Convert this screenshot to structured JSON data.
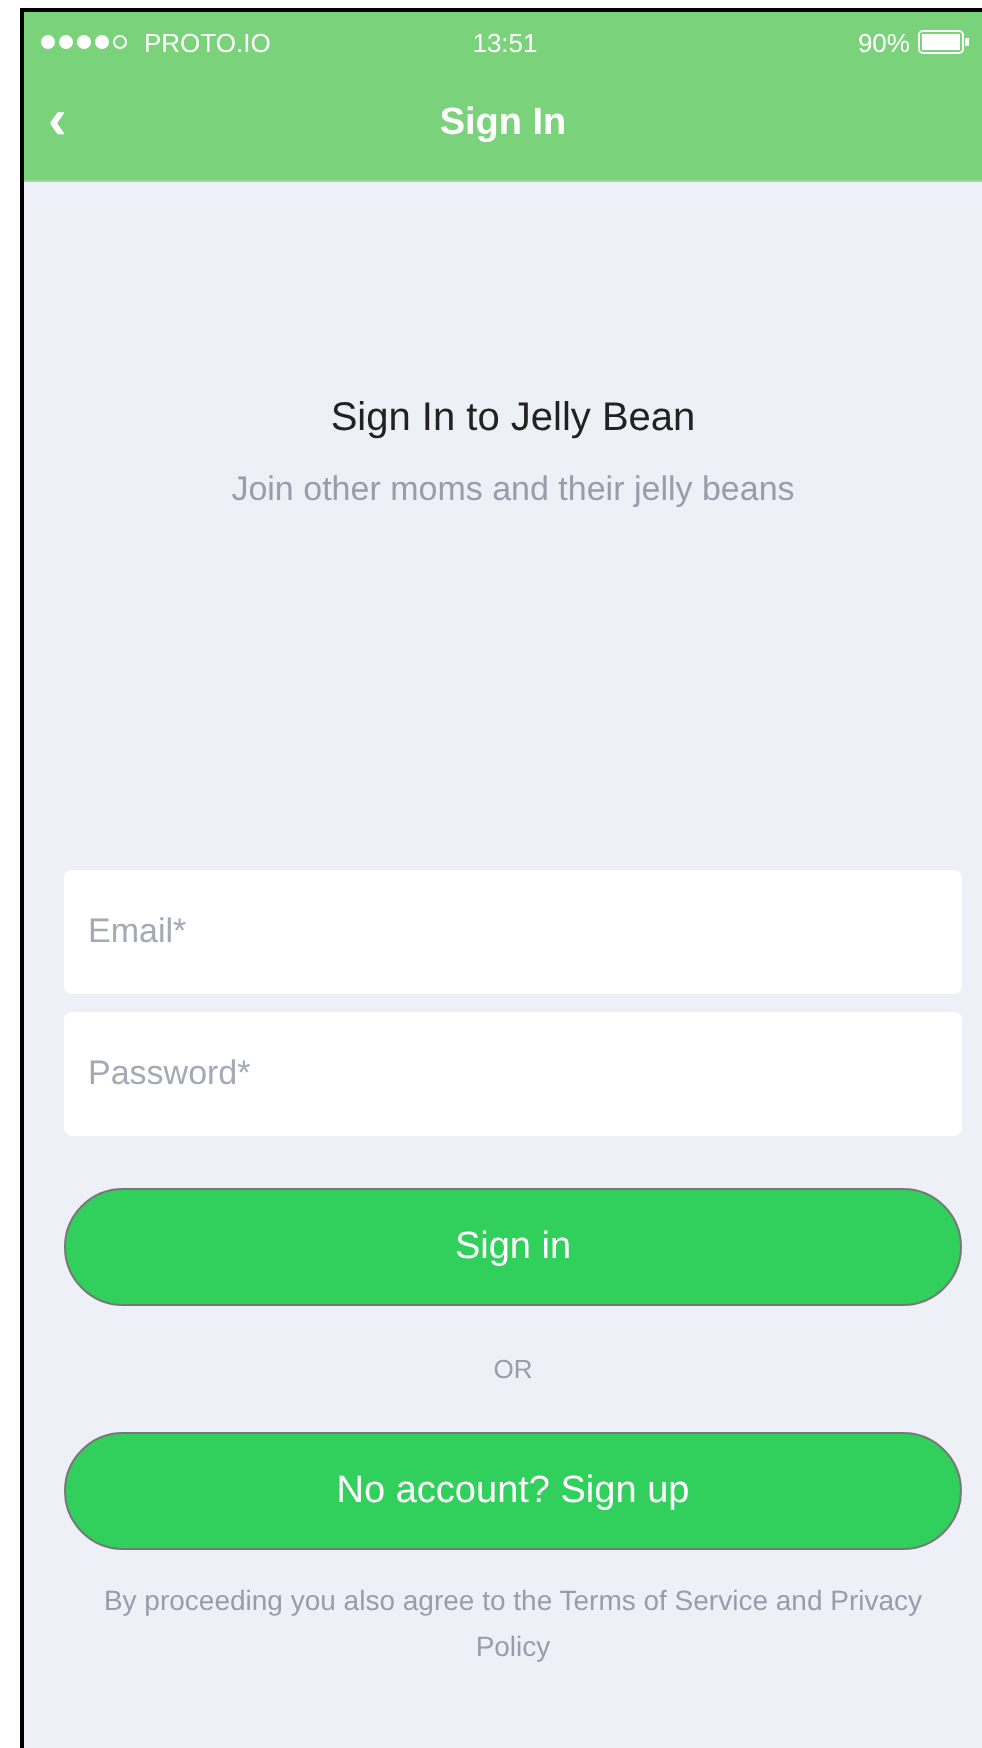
{
  "status_bar": {
    "carrier": "PROTO.IO",
    "time": "13:51",
    "battery": "90%"
  },
  "nav_bar": {
    "back": "‹",
    "title": "Sign In"
  },
  "heading": "Sign In to Jelly Bean",
  "subheading": "Join other moms and their jelly beans",
  "fields": [
    {
      "placeholder": "Email*"
    },
    {
      "placeholder": "Password*"
    }
  ],
  "sign_in_button": "Sign in",
  "divider": "OR",
  "sign_up_button": "No account? Sign up",
  "terms": "By proceeding you also agree to the Terms of Service and Privacy Policy"
}
